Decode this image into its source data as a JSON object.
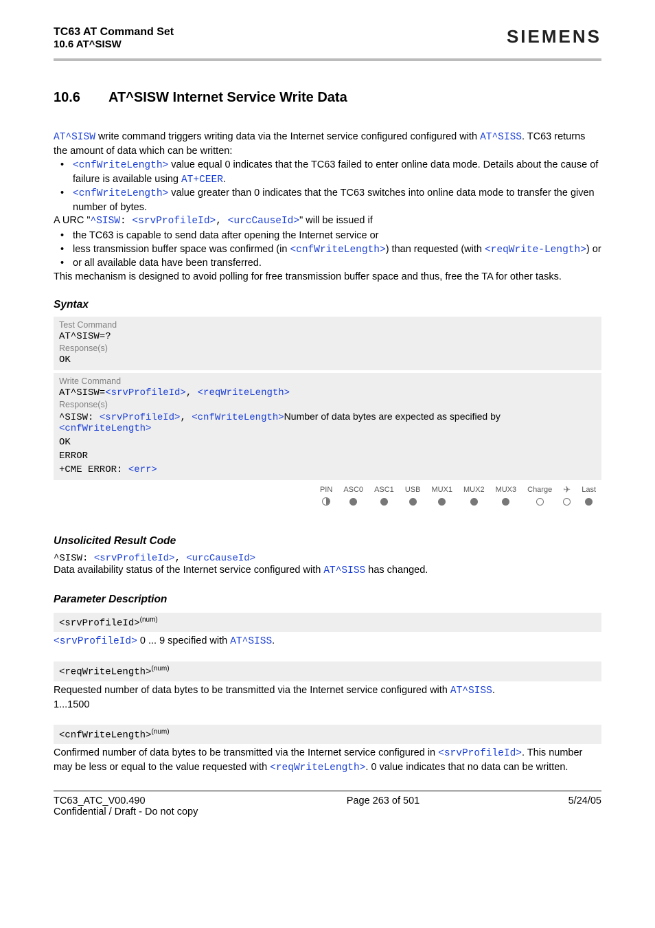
{
  "header": {
    "doc_title": "TC63 AT Command Set",
    "doc_section": "10.6 AT^SISW",
    "brand": "SIEMENS"
  },
  "section": {
    "number": "10.6",
    "title": "AT^SISW   Internet Service Write Data"
  },
  "intro": {
    "lead_cmd": "AT^SISW",
    "lead_rest": " write command triggers writing data via the Internet service configured configured with ",
    "lead_link": "AT^SISS",
    "lead_tail": ". TC63 returns the amount of data which can be written:",
    "bul1_a": "<cnfWriteLength>",
    "bul1_b": " value equal 0 indicates that the TC63 failed to enter online data mode. Details about the cause of failure is available using ",
    "bul1_c": "AT+CEER",
    "bul1_d": ".",
    "bul2_a": "<cnfWriteLength>",
    "bul2_b": " value greater than 0 indicates that the TC63 switches into online data mode to transfer the given number of bytes.",
    "urc_a": "A URC \"",
    "urc_cmd": "^SISW",
    "urc_b": ": ",
    "urc_p1": "<srvProfileId>",
    "urc_c": ", ",
    "urc_p2": "<urcCauseId>",
    "urc_d": "\" will be issued if",
    "bul3": "the TC63 is capable to send data after opening the Internet service or",
    "bul4_a": "less transmission buffer space was confirmed (in ",
    "bul4_b": "<cnfWriteLength>",
    "bul4_c": ") than requested (with ",
    "bul4_d": "<reqWrite-Length>",
    "bul4_e": ") or",
    "bul5": "or all available data have been transferred.",
    "tail": "This mechanism is designed to avoid polling for free transmission buffer space and thus, free the TA for other tasks."
  },
  "syntax": {
    "heading": "Syntax",
    "test_label": "Test Command",
    "test_cmd": "AT^SISW=?",
    "resp_label": "Response(s)",
    "ok": "OK",
    "write_label": "Write Command",
    "write_a": "AT^SISW=",
    "write_p1": "<srvProfileId>",
    "write_c": ", ",
    "write_p2": "<reqWriteLength>",
    "resp2_a": "^SISW: ",
    "resp2_p1": "<srvProfileId>",
    "resp2_c": ", ",
    "resp2_p2": "<cnfWriteLength>",
    "resp2_txt": "Number of data bytes are expected as specified by ",
    "resp2_p3": "<cnfWriteLength>",
    "error": "ERROR",
    "cme_a": "+CME ERROR: ",
    "cme_b": "<err>"
  },
  "icons": {
    "cols": [
      "PIN",
      "ASC0",
      "ASC1",
      "USB",
      "MUX1",
      "MUX2",
      "MUX3",
      "Charge",
      "",
      "Last"
    ]
  },
  "urc": {
    "heading": "Unsolicited Result Code",
    "line_a": "^SISW: ",
    "line_p1": "<srvProfileId>",
    "line_c": ", ",
    "line_p2": "<urcCauseId>",
    "desc_a": "Data availability status of the Internet service configured with ",
    "desc_link": "AT^SISS",
    "desc_b": " has changed."
  },
  "params": {
    "heading": "Parameter Description",
    "p1_name": "<srvProfileId>",
    "p1_sup": "(num)",
    "p1_a": "<srvProfileId>",
    "p1_b": " 0 ... 9 specified with ",
    "p1_c": "AT^SISS",
    "p1_d": ".",
    "p2_name": "<reqWriteLength>",
    "p2_sup": "(num)",
    "p2_a": "Requested number of data bytes to be transmitted via the Internet service configured with ",
    "p2_b": "AT^SISS",
    "p2_c": ".",
    "p2_range": "1...1500",
    "p3_name": "<cnfWriteLength>",
    "p3_sup": "(num)",
    "p3_a": "Confirmed number of data bytes to be transmitted via the Internet service configured in ",
    "p3_b": "<srvProfileId>",
    "p3_c": ". This number may be less or equal to the value requested with ",
    "p3_d": "<reqWriteLength>",
    "p3_e": ". 0 value indicates that no data can be written."
  },
  "footer": {
    "left1": "TC63_ATC_V00.490",
    "left2": "Confidential / Draft - Do not copy",
    "center": "Page 263 of 501",
    "right": "5/24/05"
  }
}
